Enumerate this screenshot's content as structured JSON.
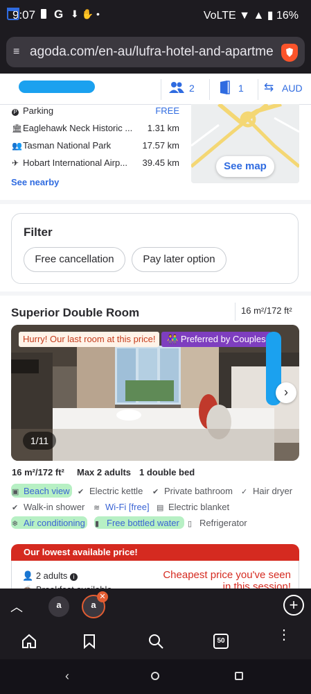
{
  "status": {
    "time": "9:07",
    "google": "G",
    "icons": "⬇ ✋ •",
    "right": "VoLTE ▼ ▲ ▮ 16%"
  },
  "browser": {
    "url": "agoda.com/en-au/lufra-hotel-and-apartments",
    "tune_icon": "≡",
    "brave_icon": "brave-lion-icon"
  },
  "booking": {
    "guests": "2",
    "rooms": "1",
    "currency": "AUD"
  },
  "nearby": {
    "items": [
      {
        "icon": "P",
        "name": "Parking",
        "value": "FREE"
      },
      {
        "icon": "🏛",
        "name": "Eaglehawk Neck Historic ...",
        "value": "1.31 km"
      },
      {
        "icon": "👥",
        "name": "Tasman National Park",
        "value": "17.57 km"
      },
      {
        "icon": "✈",
        "name": "Hobart International Airp...",
        "value": "39.45 km"
      }
    ],
    "see_nearby": "See nearby",
    "see_map": "See map"
  },
  "filter": {
    "title": "Filter",
    "chips": [
      "Free cancellation",
      "Pay later option"
    ]
  },
  "room": {
    "title": "Superior Double Room",
    "size_header": "16 m²/172 ft²",
    "hurry_badge": "Hurry! Our last room at this price!",
    "preferred_badge": "Preferred by Couples",
    "photo_counter": "1/11",
    "specs": [
      "16 m²/172 ft²",
      "Max 2 adults",
      "1 double bed"
    ],
    "amenities": [
      "Beach view",
      "Electric kettle",
      "Private bathroom",
      "Hair dryer",
      "Walk-in shower",
      "Wi-Fi [free]",
      "Electric blanket",
      "Air conditioning",
      "Free bottled water",
      "Refrigerator"
    ]
  },
  "price": {
    "header": "Our lowest available price!",
    "adults": "2 adults",
    "breakfast": "Breakfast available",
    "cheapest": "Cheapest price you've seen in this session!"
  },
  "bottom": {
    "tab_count": "50"
  },
  "colors": {
    "brand_blue": "#2f6be0",
    "highlight_green": "#b7f0c4",
    "price_red": "#d52a20",
    "couples_purple": "#7e3ebf"
  }
}
